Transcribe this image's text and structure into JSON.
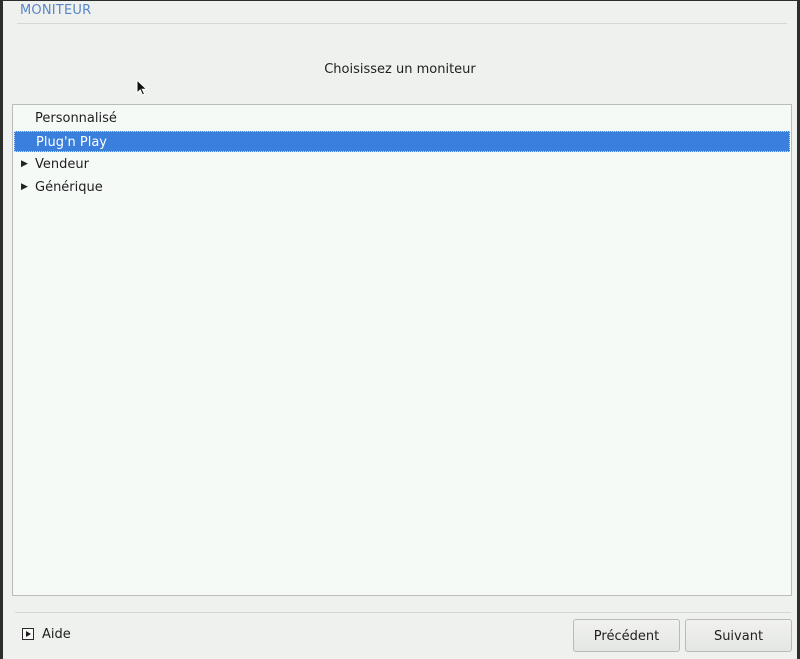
{
  "window": {
    "title": "MONITEUR"
  },
  "prompt": "Choisissez un moniteur",
  "tree": {
    "items": [
      {
        "label": "Personnalisé",
        "expandable": false,
        "selected": false
      },
      {
        "label": "Plug'n Play",
        "expandable": false,
        "selected": true
      },
      {
        "label": "Vendeur",
        "expandable": true,
        "selected": false
      },
      {
        "label": "Générique",
        "expandable": true,
        "selected": false
      }
    ]
  },
  "footer": {
    "help_label": "Aide",
    "prev_label": "Précédent",
    "next_label": "Suivant"
  },
  "colors": {
    "title": "#5a86c9",
    "selection": "#3a7fdc",
    "tree_background": "#f5faf7",
    "window_background": "#eff1ee"
  },
  "icons": {
    "expander": "triangle-right-icon",
    "help": "expand-box-icon",
    "pointer": "mouse-pointer-icon"
  }
}
